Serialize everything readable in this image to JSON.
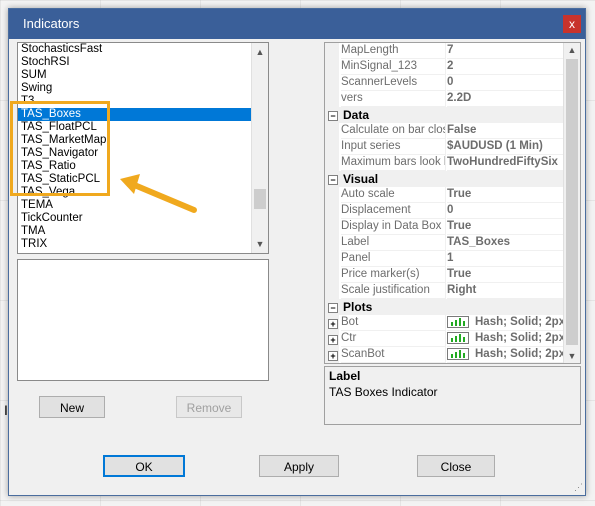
{
  "dialog": {
    "title": "Indicators",
    "close_symbol": "x"
  },
  "indicator_list": {
    "items": [
      "StochasticsFast",
      "StochRSI",
      "SUM",
      "Swing",
      "T3",
      "TAS_Boxes",
      "TAS_FloatPCL",
      "TAS_MarketMap",
      "TAS_Navigator",
      "TAS_Ratio",
      "TAS_StaticPCL",
      "TAS_Vega",
      "TEMA",
      "TickCounter",
      "TMA",
      "TRIX"
    ],
    "selected": "TAS_Boxes",
    "scroll_up": "▲",
    "scroll_down": "▼"
  },
  "buttons": {
    "new": "New",
    "remove": "Remove",
    "ok": "OK",
    "apply": "Apply",
    "close": "Close"
  },
  "properties": {
    "top_rows": [
      {
        "name": "MapLength",
        "value": "7"
      },
      {
        "name": "MinSignal_123",
        "value": "2"
      },
      {
        "name": "ScannerLevels",
        "value": "0"
      },
      {
        "name": "vers",
        "value": "2.2D"
      }
    ],
    "data": {
      "label": "Data",
      "rows": [
        {
          "name": "Calculate on bar clos",
          "value": "False"
        },
        {
          "name": "Input series",
          "value": "$AUDUSD (1 Min)"
        },
        {
          "name": "Maximum bars look b",
          "value": "TwoHundredFiftySix"
        }
      ]
    },
    "visual": {
      "label": "Visual",
      "rows": [
        {
          "name": "Auto scale",
          "value": "True"
        },
        {
          "name": "Displacement",
          "value": "0"
        },
        {
          "name": "Display in Data Box",
          "value": "True"
        },
        {
          "name": "Label",
          "value": "TAS_Boxes"
        },
        {
          "name": "Panel",
          "value": "1"
        },
        {
          "name": "Price marker(s)",
          "value": "True"
        },
        {
          "name": "Scale justification",
          "value": "Right"
        }
      ]
    },
    "plots": {
      "label": "Plots",
      "rows": [
        {
          "name": "Bot",
          "value": "Hash; Solid; 2px"
        },
        {
          "name": "Ctr",
          "value": "Hash; Solid; 2px"
        },
        {
          "name": "ScanBot",
          "value": "Hash; Solid; 2px"
        }
      ]
    },
    "collapse_symbol": "−",
    "expand_symbol": "+"
  },
  "help": {
    "title": "Label",
    "text": "TAS Boxes Indicator"
  },
  "colors": {
    "title_bar": "#3a5f99",
    "selection": "#0078d7",
    "highlight": "#f0a91e"
  }
}
